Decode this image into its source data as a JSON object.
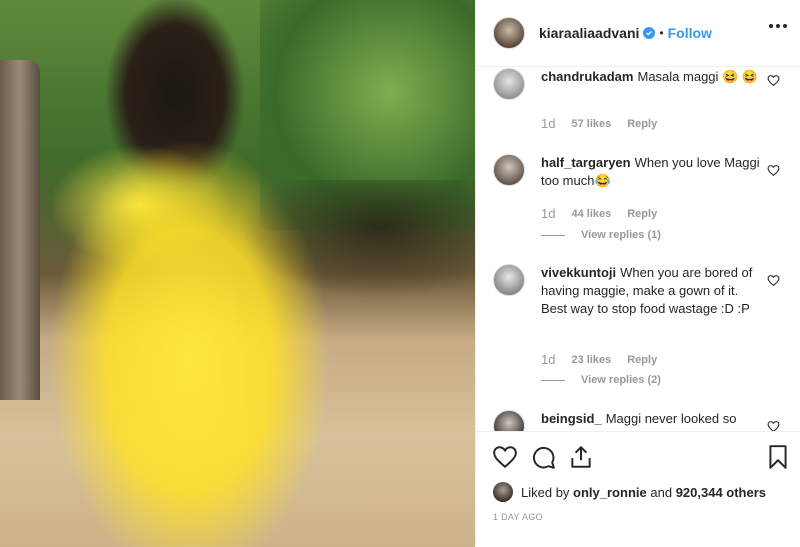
{
  "header": {
    "username": "kiaraaliaadvani",
    "separator": "•",
    "follow_label": "Follow"
  },
  "comments": [
    {
      "username": "chandrukadam",
      "text": "Masala maggi 😆 😆",
      "time": "1d",
      "likes": "57 likes",
      "reply": "Reply"
    },
    {
      "username": "half_targaryen",
      "text": "When you love Maggi too much😂",
      "time": "1d",
      "likes": "44 likes",
      "reply": "Reply",
      "view_replies": "View replies (1)"
    },
    {
      "username": "vivekkuntoji",
      "text": "When you are bored of having maggie, make a gown of it. Best way to stop food wastage :D :P",
      "time": "1d",
      "likes": "23 likes",
      "reply": "Reply",
      "view_replies": "View replies (2)"
    },
    {
      "username": "beingsid_",
      "text": "Maggi never looked so"
    }
  ],
  "footer": {
    "liked_prefix": "Liked by",
    "liked_user": "only_ronnie",
    "liked_and": "and",
    "liked_count": "920,344 others",
    "timestamp": "1 DAY AGO"
  },
  "icons": {
    "verified": "verified-badge-icon",
    "more": "more-options-icon",
    "like": "heart-icon",
    "comment": "comment-icon",
    "share": "share-icon",
    "save": "bookmark-icon"
  },
  "colors": {
    "accent": "#3897f0",
    "text": "#262626",
    "muted": "#999999"
  }
}
